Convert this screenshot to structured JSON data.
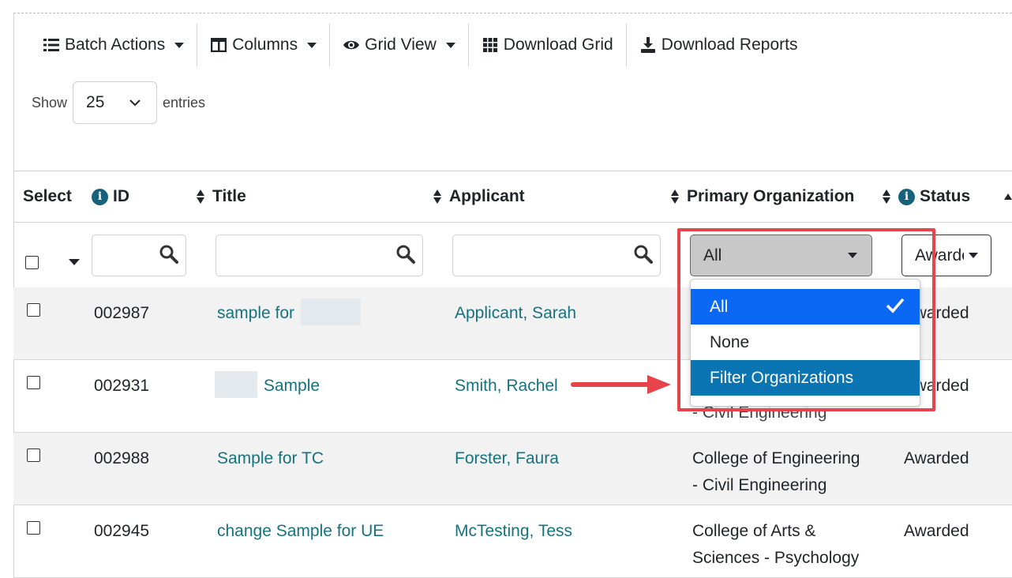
{
  "toolbar": {
    "batch_actions": "Batch Actions",
    "columns": "Columns",
    "grid_view": "Grid View",
    "download_grid": "Download Grid",
    "download_reports": "Download Reports"
  },
  "length": {
    "show_label": "Show",
    "value": "25",
    "entries_label": "entries"
  },
  "columns": {
    "select": "Select",
    "id": "ID",
    "title": "Title",
    "applicant": "Applicant",
    "primary_org": "Primary Organization",
    "status": "Status"
  },
  "filters": {
    "org_value": "All",
    "status_value": "Awarded"
  },
  "org_menu": {
    "items": [
      "All",
      "None",
      "Filter Organizations"
    ],
    "selected": "All"
  },
  "rows": [
    {
      "id": "002987",
      "title": "sample for",
      "applicant": "Applicant, Sarah",
      "org_line1": "",
      "org_line2": "",
      "status": "Awarded"
    },
    {
      "id": "002931",
      "title": "Sample",
      "applicant": "Smith, Rachel",
      "org_line1": "",
      "org_line2": "- Civil Engineering",
      "status": "Awarded"
    },
    {
      "id": "002988",
      "title": "Sample for TC",
      "applicant": "Forster, Faura",
      "org_line1": "College of Engineering",
      "org_line2": "- Civil Engineering",
      "status": "Awarded"
    },
    {
      "id": "002945",
      "title": "change Sample for UE",
      "applicant": "McTesting, Tess",
      "org_line1": "College of Arts &",
      "org_line2": "Sciences - Psychology",
      "status": "Awarded"
    }
  ],
  "colors": {
    "link": "#17727f",
    "menu_active": "#0a68f5",
    "menu_filter": "#0b74b3",
    "annotation": "#e5444a",
    "info_icon": "#17627a"
  }
}
